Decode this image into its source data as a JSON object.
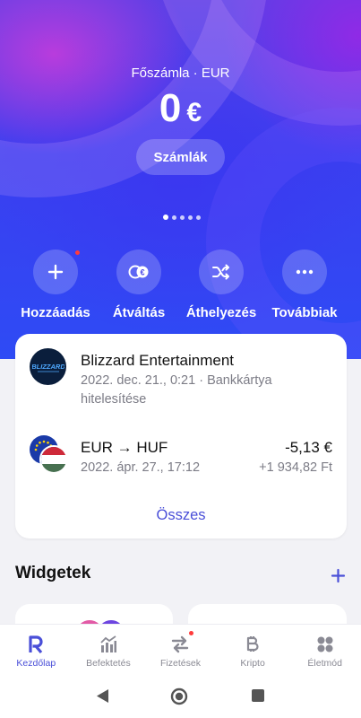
{
  "hero": {
    "account_label": "Főszámla · EUR",
    "balance_amount": "0",
    "balance_currency": "€",
    "accounts_button": "Számlák",
    "page_dots": 5,
    "active_dot": 0
  },
  "actions": [
    {
      "label": "Hozzáadás",
      "icon": "plus-icon",
      "badge": true
    },
    {
      "label": "Átváltás",
      "icon": "exchange-icon",
      "badge": false
    },
    {
      "label": "Áthelyezés",
      "icon": "shuffle-icon",
      "badge": false
    },
    {
      "label": "Továbbiak",
      "icon": "more-icon",
      "badge": false
    }
  ],
  "transactions": {
    "items": [
      {
        "title": "Blizzard Entertainment",
        "subtitle": "2022. dec. 21., 0:21 · Bankkártya hitelesítése",
        "logo": "blizzard-logo",
        "logo_text": "BLIZZARD"
      },
      {
        "title": "EUR → HUF",
        "subtitle": "2022. ápr. 27., 17:12",
        "amount": "-5,13 €",
        "amount_secondary": "+1 934,82 Ft",
        "icon": "eur-huf-flags-icon"
      }
    ],
    "see_all": "Összes"
  },
  "widgets": {
    "title": "Widgetek",
    "add_icon": "plus-icon"
  },
  "tabbar": [
    {
      "label": "Kezdőlap",
      "icon": "revolut-r-icon",
      "active": true
    },
    {
      "label": "Befektetés",
      "icon": "chart-bars-icon",
      "active": false
    },
    {
      "label": "Fizetések",
      "icon": "transfer-arrows-icon",
      "active": false,
      "badge": true
    },
    {
      "label": "Kripto",
      "icon": "bitcoin-icon",
      "active": false
    },
    {
      "label": "Életmód",
      "icon": "four-dots-icon",
      "active": false
    }
  ],
  "colors": {
    "accent": "#4a4fd8",
    "badge": "#ff3b3b",
    "hero_start": "#5a3fe6",
    "hero_end": "#2e4bf5"
  }
}
